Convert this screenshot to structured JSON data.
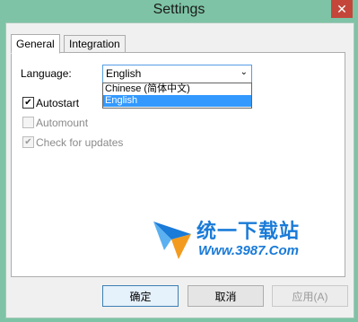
{
  "window": {
    "title": "Settings",
    "close_glyph": "✕"
  },
  "tabs": [
    {
      "label": "General"
    },
    {
      "label": "Integration"
    }
  ],
  "general": {
    "language_label": "Language:",
    "language_value": "English",
    "language_options": [
      "Chinese (简体中文)",
      "English"
    ],
    "autostart_label": "Autostart",
    "automount_label": "Automount",
    "check_updates_label": "Check for updates"
  },
  "watermark": {
    "cn": "统一下载站",
    "en": "Www.3987.Com"
  },
  "buttons": {
    "ok": "确定",
    "cancel": "取消",
    "apply": "应用(A)"
  },
  "colors": {
    "accent": "#3399ff",
    "frame": "#7ec3a5",
    "close": "#c4463a",
    "watermark": "#1a7bd8"
  }
}
